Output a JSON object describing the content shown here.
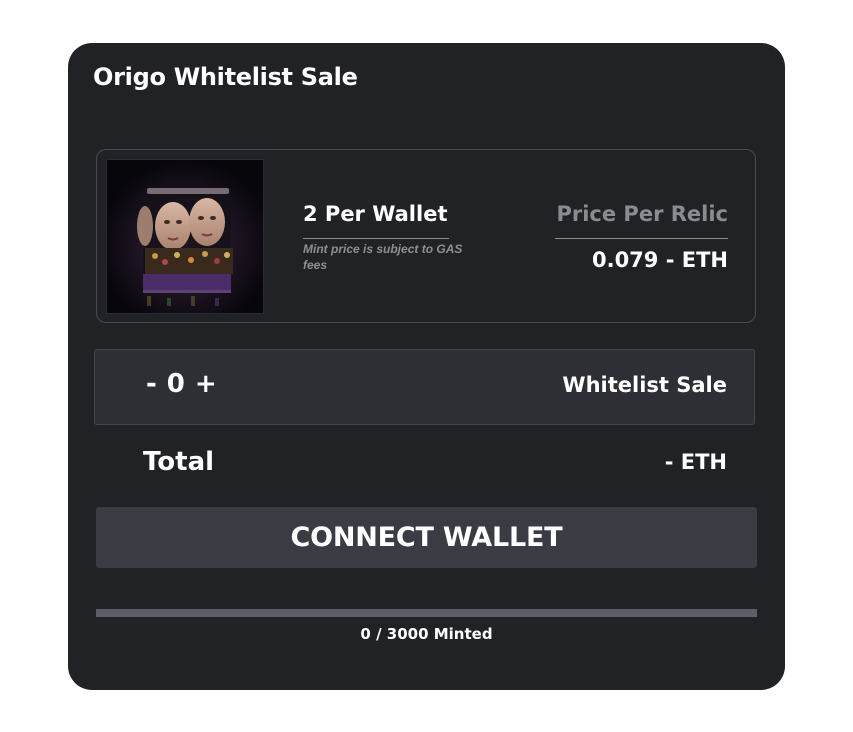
{
  "card": {
    "title": "Origo Whitelist Sale"
  },
  "product": {
    "image_alt": "relic-artwork",
    "per_wallet": "2 Per Wallet",
    "mint_note": "Mint price is subject to GAS fees",
    "price_label": "Price Per Relic",
    "price_value": "0.079 - ETH"
  },
  "quantity": {
    "decrement": "-",
    "value": "0",
    "increment": "+",
    "sale_type": "Whitelist Sale"
  },
  "total": {
    "label": "Total",
    "value": "- ETH"
  },
  "connect_button": {
    "label": "CONNECT WALLET"
  },
  "progress": {
    "minted": 0,
    "supply": 3000,
    "fraction": 0,
    "label": "0 / 3000 Minted"
  },
  "colors": {
    "card_bg": "#212225",
    "qty_bg": "#2e2f34",
    "button_bg": "#3a3c44",
    "muted_text": "#8b8c91",
    "progress_track": "#5c5f67"
  }
}
